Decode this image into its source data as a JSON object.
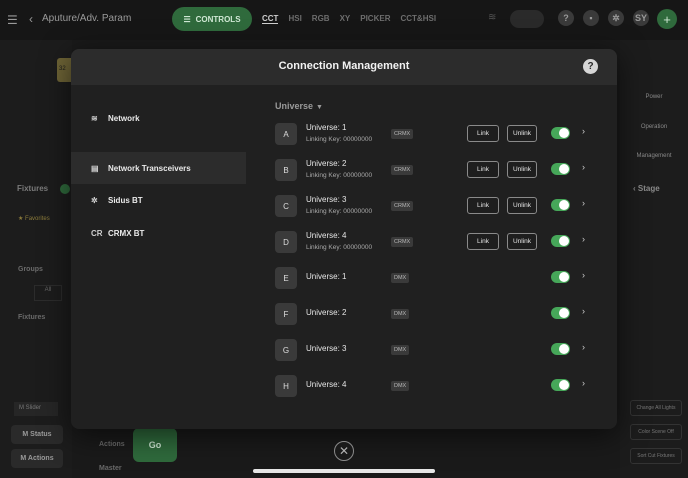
{
  "app": {
    "title": "Aputure/Adv. Param",
    "controls_label": "CONTROLS",
    "tabs": [
      {
        "label": "CCT",
        "active": true
      },
      {
        "label": "HSI",
        "active": false
      },
      {
        "label": "RGB",
        "active": false
      },
      {
        "label": "XY",
        "active": false
      },
      {
        "label": "PICKER",
        "active": false
      },
      {
        "label": "CCT&HSI",
        "active": false
      }
    ],
    "avatar": "SY"
  },
  "background": {
    "fixtures_label": "Fixtures",
    "favorites_label": "Favorites",
    "groups_label": "Groups",
    "all_label": "All",
    "fixtures_section_label": "Fixtures",
    "slider_label": "M Slider",
    "status_label": "M Status",
    "actions_label": "M Actions",
    "bottom_actions_label": "Actions",
    "go_label": "Go",
    "master_label": "Master",
    "stage_label": "Stage",
    "right_labels": [
      "Power",
      "Operation",
      "Management"
    ],
    "right_buttons": [
      "Change All Lights",
      "Color Scene Off",
      "Sort Cut Fixtures"
    ]
  },
  "modal": {
    "title": "Connection Management",
    "help_symbol": "?",
    "nav": [
      {
        "label": "Network",
        "icon": "wifi-icon",
        "glyph": "≋",
        "active": false
      },
      {
        "label": "Network Transceivers",
        "icon": "transceiver-icon",
        "glyph": "▤",
        "active": true
      },
      {
        "label": "Sidus BT",
        "icon": "bluetooth-gear-icon",
        "glyph": "✲",
        "active": false
      },
      {
        "label": "CRMX BT",
        "icon": "crmx-icon",
        "glyph": "CR",
        "active": false
      }
    ],
    "universe_dropdown": "Universe",
    "link_label": "Link",
    "unlink_label": "Unlink",
    "universes": [
      {
        "letter": "A",
        "name": "Universe: 1",
        "key": "Linking Key: 00000000",
        "protocol": "CRMX",
        "has_link": true,
        "enabled": true
      },
      {
        "letter": "B",
        "name": "Universe: 2",
        "key": "Linking Key: 00000000",
        "protocol": "CRMX",
        "has_link": true,
        "enabled": true
      },
      {
        "letter": "C",
        "name": "Universe: 3",
        "key": "Linking Key: 00000000",
        "protocol": "CRMX",
        "has_link": true,
        "enabled": true
      },
      {
        "letter": "D",
        "name": "Universe: 4",
        "key": "Linking Key: 00000000",
        "protocol": "CRMX",
        "has_link": true,
        "enabled": true
      },
      {
        "letter": "E",
        "name": "Universe: 1",
        "key": "",
        "protocol": "DMX",
        "has_link": false,
        "enabled": true
      },
      {
        "letter": "F",
        "name": "Universe: 2",
        "key": "",
        "protocol": "DMX",
        "has_link": false,
        "enabled": true
      },
      {
        "letter": "G",
        "name": "Universe: 3",
        "key": "",
        "protocol": "DMX",
        "has_link": false,
        "enabled": true
      },
      {
        "letter": "H",
        "name": "Universe: 4",
        "key": "",
        "protocol": "DMX",
        "has_link": false,
        "enabled": true
      }
    ]
  },
  "colors": {
    "accent_green": "#46a759",
    "controls_green": "#2f6a3c",
    "modal_bg": "#202020",
    "header_bg": "#2c2c2c"
  }
}
